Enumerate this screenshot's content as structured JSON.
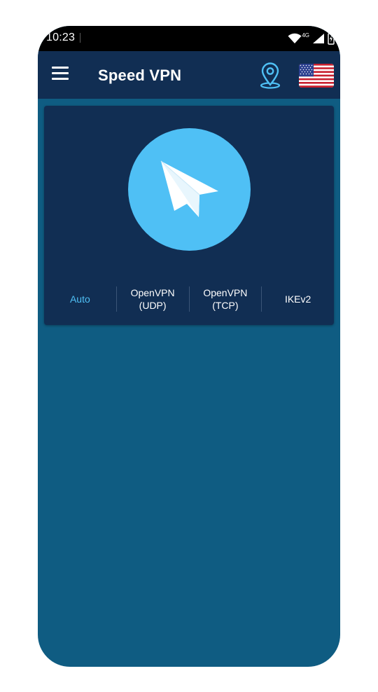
{
  "status_bar": {
    "time": "10:23",
    "network": "4G"
  },
  "app_bar": {
    "title": "Speed VPN",
    "menu_icon": "hamburger-menu-icon",
    "location_icon": "location-pin-icon",
    "flag_icon": "us-flag-icon"
  },
  "colors": {
    "app_bar": "#112e53",
    "card": "#112e53",
    "background": "#0f5c82",
    "accent": "#4fc0f5"
  },
  "connect_button": {
    "icon": "paper-plane-icon"
  },
  "protocols": [
    {
      "label": "Auto",
      "selected": true
    },
    {
      "label": "OpenVPN\n(UDP)",
      "selected": false
    },
    {
      "label": "OpenVPN\n(TCP)",
      "selected": false
    },
    {
      "label": "IKEv2",
      "selected": false
    }
  ]
}
